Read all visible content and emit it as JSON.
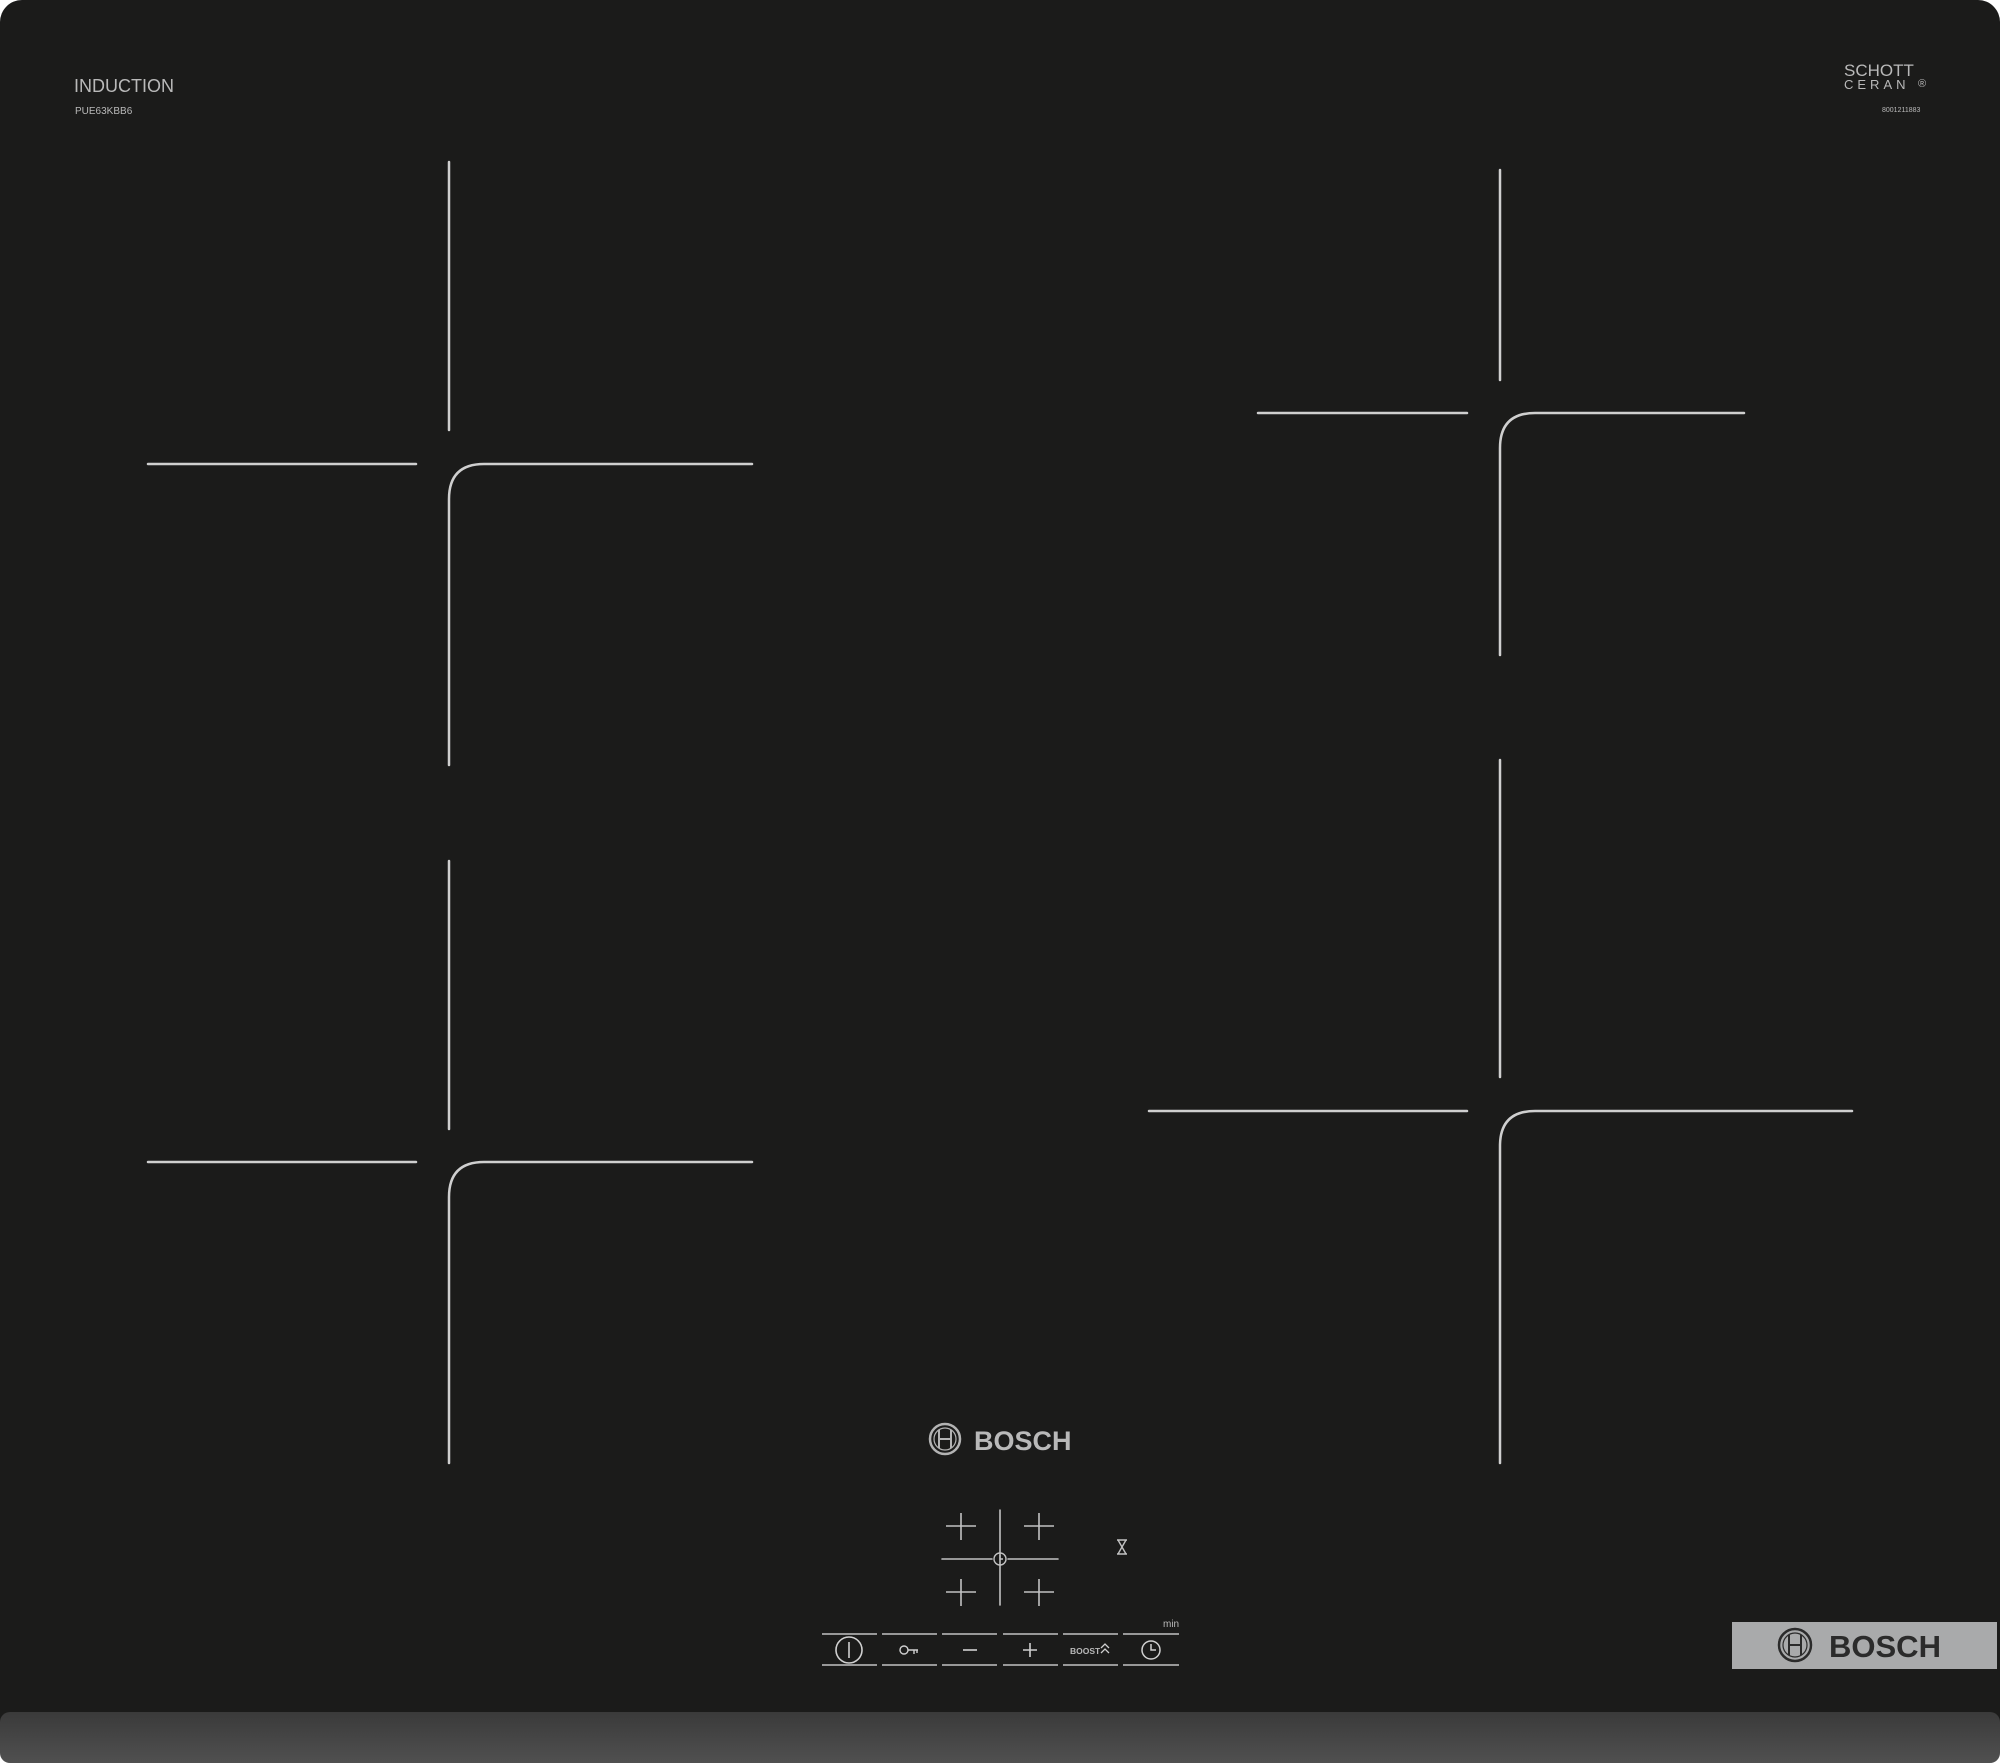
{
  "hob": {
    "type_label": "INDUCTION",
    "model_code": "PUE63KBB6",
    "glass_brand_line1": "SCHOTT",
    "glass_brand_line2": "CERAN",
    "glass_brand_mark": "®",
    "serial_code": "8001211883",
    "center_brand": "BOSCH",
    "badge_brand": "BOSCH",
    "timer_unit": "min",
    "boost_label": "BOOST"
  },
  "zones": [
    {
      "id": "front-left"
    },
    {
      "id": "rear-left"
    },
    {
      "id": "rear-right"
    },
    {
      "id": "front-right"
    }
  ],
  "controls": {
    "buttons": [
      {
        "id": "power",
        "icon": "power-icon"
      },
      {
        "id": "child-lock",
        "icon": "key-icon"
      },
      {
        "id": "minus",
        "icon": "minus-icon"
      },
      {
        "id": "plus",
        "icon": "plus-icon"
      },
      {
        "id": "boost",
        "icon": "boost-icon"
      },
      {
        "id": "timer",
        "icon": "clock-icon"
      }
    ]
  },
  "colors": {
    "glass": "#1b1b1a",
    "frame": "#454545",
    "markings": "#cfcfcf",
    "badge": "#a9aaab"
  }
}
